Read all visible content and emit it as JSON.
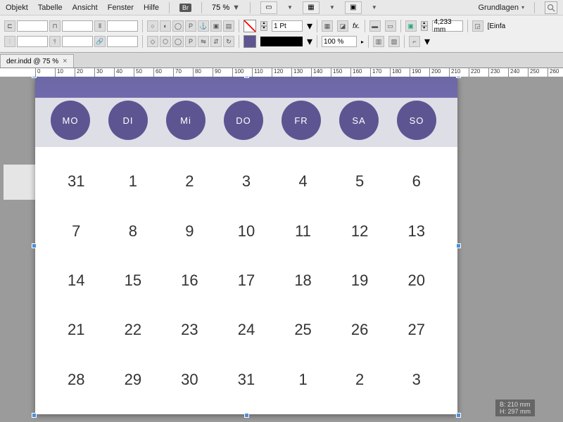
{
  "menu": {
    "items": [
      "Objekt",
      "Tabelle",
      "Ansicht",
      "Fenster",
      "Hilfe"
    ],
    "bridge": "Br",
    "zoom": "75 %",
    "workspace": "Grundlagen"
  },
  "control": {
    "strokeWeight": "1 Pt",
    "opacity": "100 %",
    "measurement": "4,233 mm",
    "einf": "[Einfa"
  },
  "tab": {
    "filename": "der.indd @ 75 %"
  },
  "ruler": {
    "marks": [
      "0",
      "10",
      "20",
      "30",
      "40",
      "50",
      "60",
      "70",
      "80",
      "90",
      "100",
      "110",
      "120",
      "130",
      "140",
      "150",
      "160",
      "170",
      "180",
      "190",
      "200",
      "210",
      "220",
      "230",
      "240",
      "250",
      "260"
    ]
  },
  "calendar": {
    "days": [
      "MO",
      "DI",
      "Mi",
      "DO",
      "FR",
      "SA",
      "SO"
    ],
    "cells": [
      "31",
      "1",
      "2",
      "3",
      "4",
      "5",
      "6",
      "7",
      "8",
      "9",
      "10",
      "11",
      "12",
      "13",
      "14",
      "15",
      "16",
      "17",
      "18",
      "19",
      "20",
      "21",
      "22",
      "23",
      "24",
      "25",
      "26",
      "27",
      "28",
      "29",
      "30",
      "31",
      "1",
      "2",
      "3"
    ]
  },
  "sizeTip": {
    "w": "B: 210 mm",
    "h": "H: 297 mm"
  }
}
